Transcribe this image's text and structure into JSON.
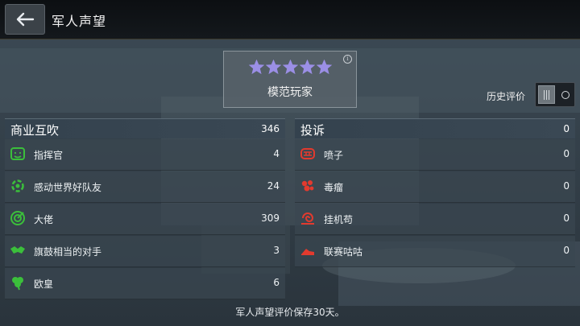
{
  "header": {
    "title": "军人声望"
  },
  "rating": {
    "stars": 5,
    "max_stars": 5,
    "title": "模范玩家"
  },
  "history": {
    "label": "历史评价",
    "toggle_on": false
  },
  "praise": {
    "title": "商业互吹",
    "count": "346",
    "items": [
      {
        "label": "指挥官",
        "count": "4",
        "icon": "commander-icon"
      },
      {
        "label": "感动世界好队友",
        "count": "24",
        "icon": "teammate-icon"
      },
      {
        "label": "大佬",
        "count": "309",
        "icon": "target-icon"
      },
      {
        "label": "旗鼓相当的对手",
        "count": "3",
        "icon": "handshake-icon"
      },
      {
        "label": "欧皇",
        "count": "6",
        "icon": "clover-icon"
      }
    ]
  },
  "complaints": {
    "title": "投诉",
    "count": "0",
    "items": [
      {
        "label": "喷子",
        "count": "0",
        "icon": "toxic-mouth-icon"
      },
      {
        "label": "毒瘤",
        "count": "0",
        "icon": "tumor-icon"
      },
      {
        "label": "挂机苟",
        "count": "0",
        "icon": "snail-icon"
      },
      {
        "label": "联赛咕咕",
        "count": "0",
        "icon": "shoe-icon"
      }
    ]
  },
  "footer": {
    "note": "军人声望评价保存30天。"
  },
  "colors": {
    "praise_icon": "#3bbf3b",
    "complaint_icon": "#e23a2e",
    "star": "#9b8fe6"
  }
}
